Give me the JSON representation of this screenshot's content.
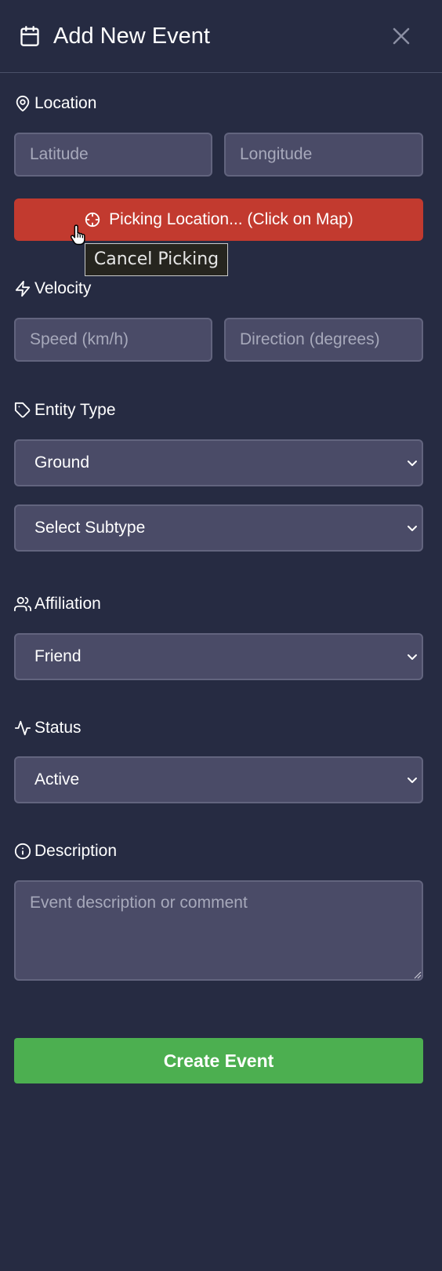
{
  "header": {
    "title": "Add New Event",
    "icon": "calendar-icon",
    "close_icon": "close-icon"
  },
  "location": {
    "label": "Location",
    "icon": "map-pin-icon",
    "latitude_placeholder": "Latitude",
    "longitude_placeholder": "Longitude",
    "pick_button_label": "Picking Location... (Click on Map)",
    "pick_button_icon": "crosshair-icon",
    "tooltip": "Cancel Picking"
  },
  "velocity": {
    "label": "Velocity",
    "icon": "lightning-icon",
    "speed_placeholder": "Speed (km/h)",
    "direction_placeholder": "Direction (degrees)"
  },
  "entity_type": {
    "label": "Entity Type",
    "icon": "tag-icon",
    "type_value": "Ground",
    "subtype_value": "Select Subtype"
  },
  "affiliation": {
    "label": "Affiliation",
    "icon": "users-icon",
    "value": "Friend"
  },
  "status": {
    "label": "Status",
    "icon": "activity-icon",
    "value": "Active"
  },
  "description": {
    "label": "Description",
    "icon": "info-icon",
    "placeholder": "Event description or comment"
  },
  "submit": {
    "label": "Create Event"
  },
  "colors": {
    "background": "#262b42",
    "field_bg": "#4a4b67",
    "picking_button": "#c23a2f",
    "create_button": "#4caf50"
  }
}
